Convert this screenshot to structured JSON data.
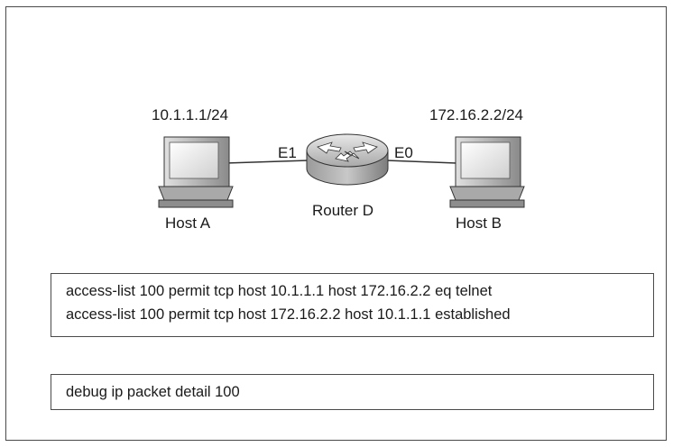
{
  "topology": {
    "host_a": {
      "ip": "10.1.1.1/24",
      "name": "Host A"
    },
    "host_b": {
      "ip": "172.16.2.2/24",
      "name": "Host B"
    },
    "router": {
      "name": "Router D",
      "left_interface": "E1",
      "right_interface": "E0"
    }
  },
  "config": {
    "acl_lines": [
      "access-list 100 permit tcp host 10.1.1.1 host 172.16.2.2 eq telnet",
      "access-list 100 permit tcp host 172.16.2.2 host 10.1.1.1 established"
    ],
    "debug_command": "debug ip packet detail 100"
  }
}
